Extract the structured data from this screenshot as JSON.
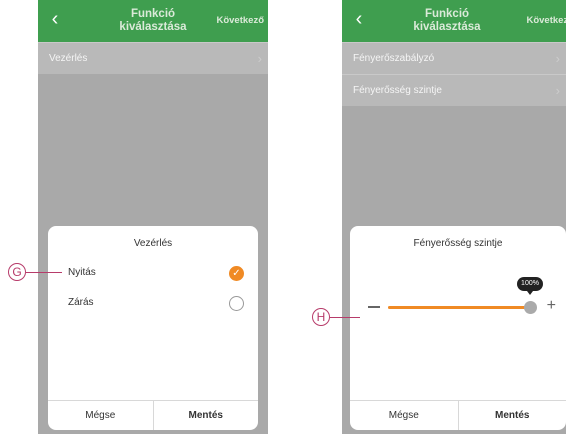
{
  "left_screen": {
    "topbar": {
      "back_icon": "chevron-left-icon",
      "title_line1": "Funkció",
      "title_line2": "kiválasztása",
      "next_label": "Következő"
    },
    "list": [
      {
        "label": "Vezérlés",
        "chevron": "›"
      }
    ],
    "sheet": {
      "title": "Vezérlés",
      "options": [
        {
          "label": "Nyitás",
          "selected": true,
          "mark": "✓"
        },
        {
          "label": "Zárás",
          "selected": false
        }
      ],
      "cancel_label": "Mégse",
      "save_label": "Mentés"
    }
  },
  "right_screen": {
    "topbar": {
      "back_icon": "chevron-left-icon",
      "title_line1": "Funkció",
      "title_line2": "kiválasztása",
      "next_label": "Következő"
    },
    "list": [
      {
        "label": "Fényerőszabályzó",
        "chevron": "›"
      },
      {
        "label": "Fényerősség szintje",
        "chevron": "›"
      }
    ],
    "sheet": {
      "title": "Fényerősség szintje",
      "slider": {
        "value_percent": 100,
        "value_label": "100%",
        "minus": "–",
        "plus": "+"
      },
      "cancel_label": "Mégse",
      "save_label": "Mentés"
    }
  },
  "callouts": [
    {
      "letter": "G"
    },
    {
      "letter": "H"
    }
  ],
  "colors": {
    "header_green": "#3f9e4f",
    "accent_orange": "#f08a24",
    "callout_magenta": "#b73b6a",
    "overlay_gray": "#a9a9a9"
  }
}
